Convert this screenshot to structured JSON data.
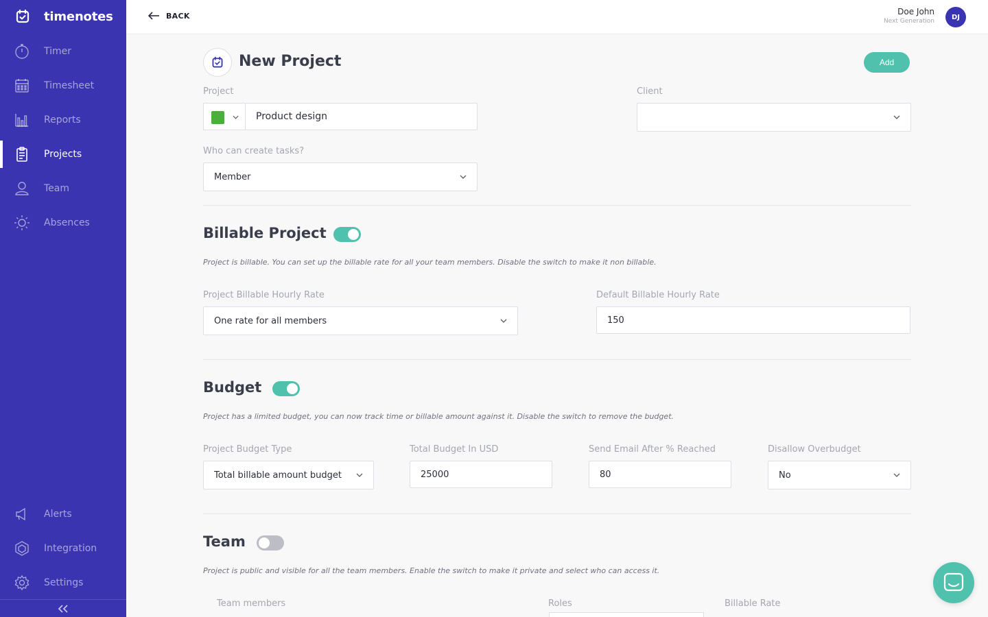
{
  "app": {
    "brand": "timenotes"
  },
  "sidebar": {
    "items": [
      {
        "label": "Timer",
        "icon": "stopwatch-icon"
      },
      {
        "label": "Timesheet",
        "icon": "calendar-grid-icon"
      },
      {
        "label": "Reports",
        "icon": "bar-chart-icon"
      },
      {
        "label": "Projects",
        "icon": "clipboard-icon",
        "active": true
      },
      {
        "label": "Team",
        "icon": "user-icon"
      },
      {
        "label": "Absences",
        "icon": "sun-icon"
      }
    ],
    "bottom_items": [
      {
        "label": "Alerts",
        "icon": "megaphone-icon"
      },
      {
        "label": "Integration",
        "icon": "integration-icon"
      },
      {
        "label": "Settings",
        "icon": "gear-icon"
      }
    ]
  },
  "header": {
    "back_label": "BACK",
    "user_name": "Doe John",
    "user_org": "Next Generation",
    "avatar_initials": "DJ"
  },
  "page": {
    "title": "New Project",
    "add_label": "Add"
  },
  "form": {
    "project_label": "Project",
    "project_name": "Product design",
    "project_color": "#4caf3c",
    "client_label": "Client",
    "client_value": "",
    "tasks_label": "Who can create tasks?",
    "tasks_value": "Member"
  },
  "billable": {
    "title": "Billable Project",
    "enabled": true,
    "description": "Project is billable. You can set up the billable rate for all your team members. Disable the switch to make it non billable.",
    "rate_type_label": "Project Billable Hourly Rate",
    "rate_type_value": "One rate for all members",
    "default_rate_label": "Default Billable Hourly Rate",
    "default_rate_value": "150"
  },
  "budget": {
    "title": "Budget",
    "enabled": true,
    "description": "Project has a limited budget, you can now track time or billable amount against it. Disable the switch to remove the budget.",
    "type_label": "Project Budget Type",
    "type_value": "Total billable amount budget",
    "total_label": "Total Budget In USD",
    "total_value": "25000",
    "email_label": "Send Email After % Reached",
    "email_value": "80",
    "overbudget_label": "Disallow Overbudget",
    "overbudget_value": "No"
  },
  "team": {
    "title": "Team",
    "enabled": false,
    "description": "Project is public and visible for all the team members. Enable the switch to make it private and select who can access it.",
    "columns": [
      "Team members",
      "Roles",
      "Billable Rate"
    ]
  },
  "colors": {
    "sidebar": "#3a34b0",
    "accent": "#4fc1ad"
  }
}
